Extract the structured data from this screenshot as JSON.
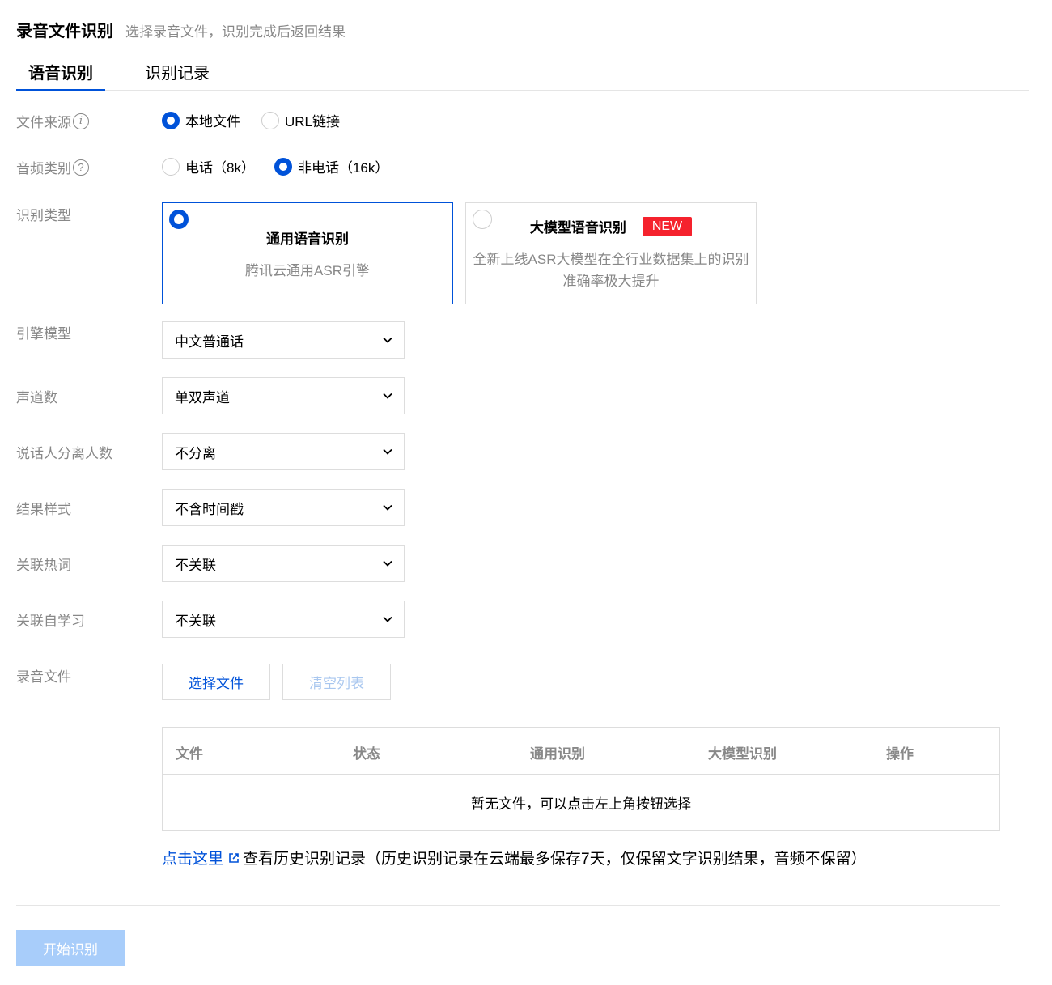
{
  "header": {
    "title": "录音文件识别",
    "subtitle": "选择录音文件，识别完成后返回结果"
  },
  "tabs": [
    {
      "label": "语音识别",
      "active": true
    },
    {
      "label": "识别记录",
      "active": false
    }
  ],
  "form": {
    "file_source": {
      "label": "文件来源",
      "options": [
        "本地文件",
        "URL链接"
      ],
      "selected": "本地文件"
    },
    "audio_type": {
      "label": "音频类别",
      "options": [
        "电话（8k）",
        "非电话（16k）"
      ],
      "selected": "非电话（16k）"
    },
    "recog_type": {
      "label": "识别类型",
      "cards": [
        {
          "title": "通用语音识别",
          "desc": "腾讯云通用ASR引擎",
          "selected": true
        },
        {
          "title": "大模型语音识别",
          "badge": "NEW",
          "desc": "全新上线ASR大模型在全行业数据集上的识别准确率极大提升",
          "selected": false
        }
      ]
    },
    "engine_model": {
      "label": "引擎模型",
      "value": "中文普通话"
    },
    "channels": {
      "label": "声道数",
      "value": "单双声道"
    },
    "speakers": {
      "label": "说话人分离人数",
      "value": "不分离"
    },
    "result_style": {
      "label": "结果样式",
      "value": "不含时间戳"
    },
    "hotwords": {
      "label": "关联热词",
      "value": "不关联"
    },
    "self_learning": {
      "label": "关联自学习",
      "value": "不关联"
    },
    "audio_file": {
      "label": "录音文件",
      "choose_label": "选择文件",
      "clear_label": "清空列表"
    }
  },
  "table": {
    "columns": [
      "文件",
      "状态",
      "通用识别",
      "大模型识别",
      "操作"
    ],
    "empty_text": "暂无文件，可以点击左上角按钮选择"
  },
  "history": {
    "link_text": "点击这里",
    "text": "查看历史识别记录（历史识别记录在云端最多保存7天，仅保留文字识别结果，音频不保留）"
  },
  "start_button": "开始识别",
  "colors": {
    "primary": "#0052d9",
    "badge": "#f5222d",
    "disabled_primary": "#a8cdfa"
  }
}
